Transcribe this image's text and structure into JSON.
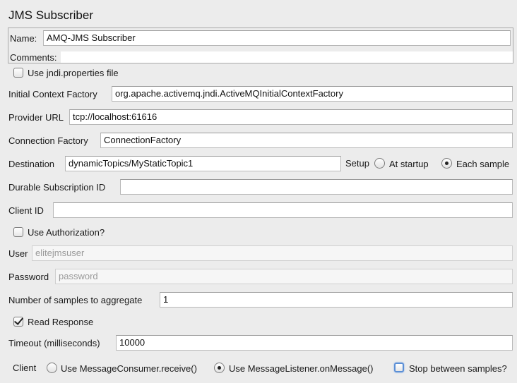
{
  "title": "JMS Subscriber",
  "name": {
    "label": "Name:",
    "value": "AMQ-JMS Subscriber"
  },
  "comments": {
    "label": "Comments:",
    "value": ""
  },
  "use_jndi": {
    "label": "Use jndi.properties file",
    "checked": false
  },
  "initial_context_factory": {
    "label": "Initial Context Factory",
    "value": "org.apache.activemq.jndi.ActiveMQInitialContextFactory"
  },
  "provider_url": {
    "label": "Provider URL",
    "value": "tcp://localhost:61616"
  },
  "connection_factory": {
    "label": "Connection Factory",
    "value": "ConnectionFactory"
  },
  "destination": {
    "label": "Destination",
    "value": "dynamicTopics/MyStaticTopic1",
    "setup_label": "Setup",
    "options": [
      "At startup",
      "Each sample"
    ],
    "selected": "Each sample"
  },
  "durable_subscription_id": {
    "label": "Durable Subscription ID",
    "value": ""
  },
  "client_id": {
    "label": "Client ID",
    "value": ""
  },
  "use_authorization": {
    "label": "Use Authorization?",
    "checked": false
  },
  "user": {
    "label": "User",
    "placeholder": "elitejmsuser",
    "value": ""
  },
  "password": {
    "label": "Password",
    "placeholder": "password",
    "value": ""
  },
  "samples_to_aggregate": {
    "label": "Number of samples to aggregate",
    "value": "1"
  },
  "read_response": {
    "label": "Read Response",
    "checked": true
  },
  "timeout": {
    "label": "Timeout (milliseconds)",
    "value": "10000"
  },
  "client": {
    "label": "Client",
    "options": [
      "Use MessageConsumer.receive()",
      "Use MessageListener.onMessage()"
    ],
    "selected": "Use MessageListener.onMessage()",
    "stop_between_samples": {
      "label": "Stop between samples?",
      "checked": false
    }
  }
}
